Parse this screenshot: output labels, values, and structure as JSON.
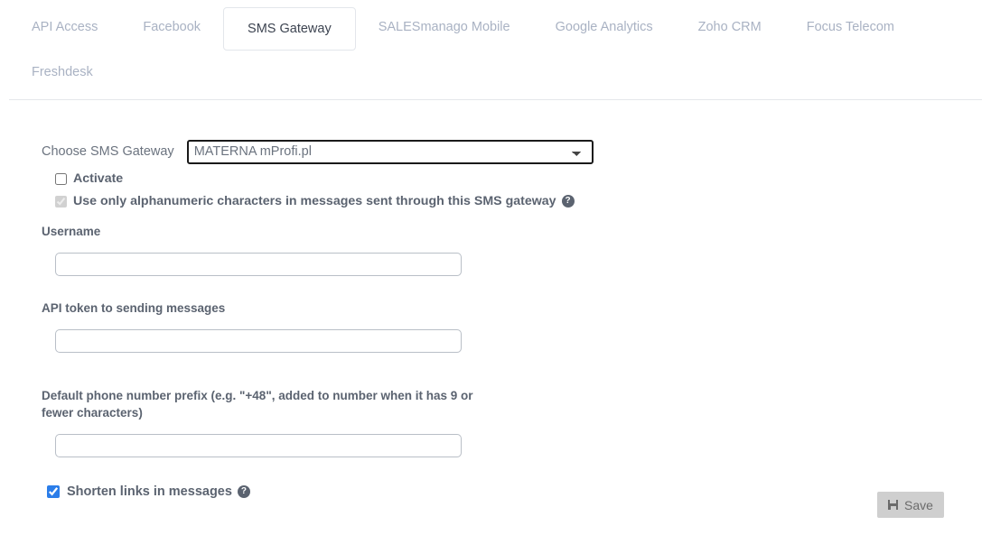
{
  "tabs": [
    {
      "label": "API Access",
      "active": false
    },
    {
      "label": "Facebook",
      "active": false
    },
    {
      "label": "SMS Gateway",
      "active": true
    },
    {
      "label": "SALESmanago Mobile",
      "active": false
    },
    {
      "label": "Google Analytics",
      "active": false
    },
    {
      "label": "Zoho CRM",
      "active": false
    },
    {
      "label": "Focus Telecom",
      "active": false
    },
    {
      "label": "Freshdesk",
      "active": false
    }
  ],
  "form": {
    "gateway_label": "Choose SMS Gateway",
    "gateway_selected": "MATERNA mProfi.pl",
    "gateway_options": [
      "MATERNA mProfi.pl"
    ],
    "activate_label": "Activate",
    "activate_checked": false,
    "alphanumeric_label": "Use only alphanumeric characters in messages sent through this SMS gateway",
    "alphanumeric_checked": true,
    "alphanumeric_disabled": true,
    "username_label": "Username",
    "username_value": "",
    "api_token_label": "API token to sending messages",
    "api_token_value": "",
    "prefix_label": "Default phone number prefix (e.g. \"+48\", added to number when it has 9 or fewer characters)",
    "prefix_value": "",
    "shorten_label": "Shorten links in messages",
    "shorten_checked": true,
    "help_icon": "help-circle-icon",
    "help_glyph": "?"
  },
  "footer": {
    "save_label": "Save",
    "save_icon": "floppy-disk-icon"
  },
  "colors": {
    "accent": "#2b7de9",
    "tab_inactive": "#a9b2c3",
    "tab_active_text": "#3d4451",
    "label": "#5b6370",
    "save_bg": "#cfcfcf"
  }
}
